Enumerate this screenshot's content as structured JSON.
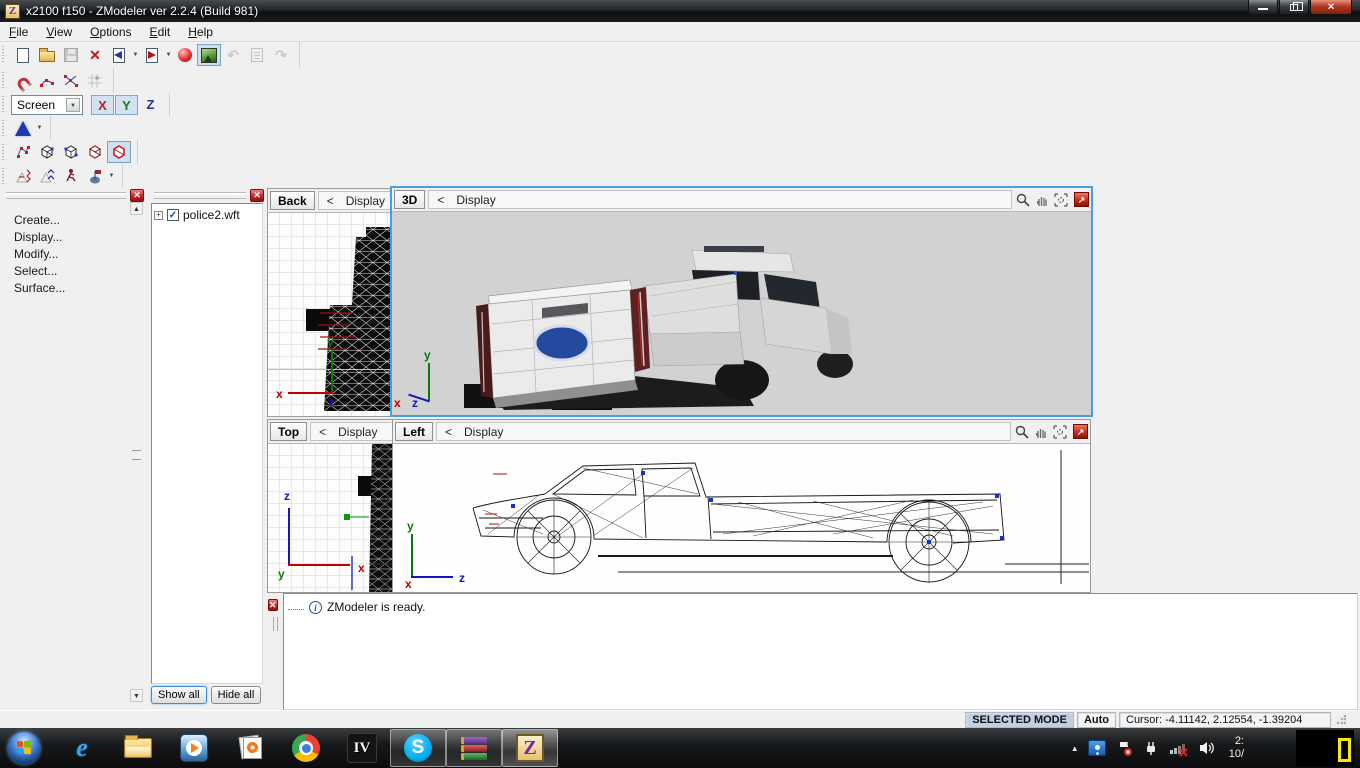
{
  "window": {
    "icon_letter": "Z",
    "title": "x2100  f150 - ZModeler ver 2.2.4 (Build 981)"
  },
  "menu": {
    "items": [
      "File",
      "View",
      "Options",
      "Edit",
      "Help"
    ]
  },
  "glyphs": {
    "close": "✕",
    "maximize": "↗",
    "dropdown": "▼",
    "up_arrow": "▲",
    "down_arrow": "▼",
    "plus": "+",
    "check": "✓",
    "info": "i",
    "undo": "↶",
    "redo": "↷",
    "delete": "✕"
  },
  "toolbar_axis": {
    "selected": "Screen",
    "x": "X",
    "y": "Y",
    "z": "Z"
  },
  "command_panel": {
    "items": [
      "Create...",
      "Display...",
      "Modify...",
      "Select...",
      "Surface..."
    ]
  },
  "tree_panel": {
    "root_label": "police2.wft",
    "show_all": "Show all",
    "hide_all": "Hide all"
  },
  "viewports": {
    "back": {
      "label": "Back",
      "nav": "<",
      "menu": "Display"
    },
    "persp": {
      "label": "3D",
      "nav": "<",
      "menu": "Display"
    },
    "top": {
      "label": "Top",
      "nav": "<",
      "menu": "Display"
    },
    "left": {
      "label": "Left",
      "nav": "<",
      "menu": "Display"
    },
    "axis": {
      "x": "x",
      "y": "y",
      "z": "z"
    }
  },
  "log": {
    "message": "ZModeler is ready."
  },
  "status": {
    "mode": "SELECTED MODE",
    "auto": "Auto",
    "cursor": "Cursor: -4.11142, 2.12554, -1.39204"
  },
  "taskbar": {
    "ie": "e",
    "iv": "IV",
    "skype": "S",
    "zmodeler": "Z",
    "clock_time": "2:",
    "clock_date": "10/"
  },
  "colors": {
    "active_viewport_border": "#45a0e2",
    "ford_oval_blue": "#234a9e",
    "taskbar_accent": "#00aff0"
  }
}
